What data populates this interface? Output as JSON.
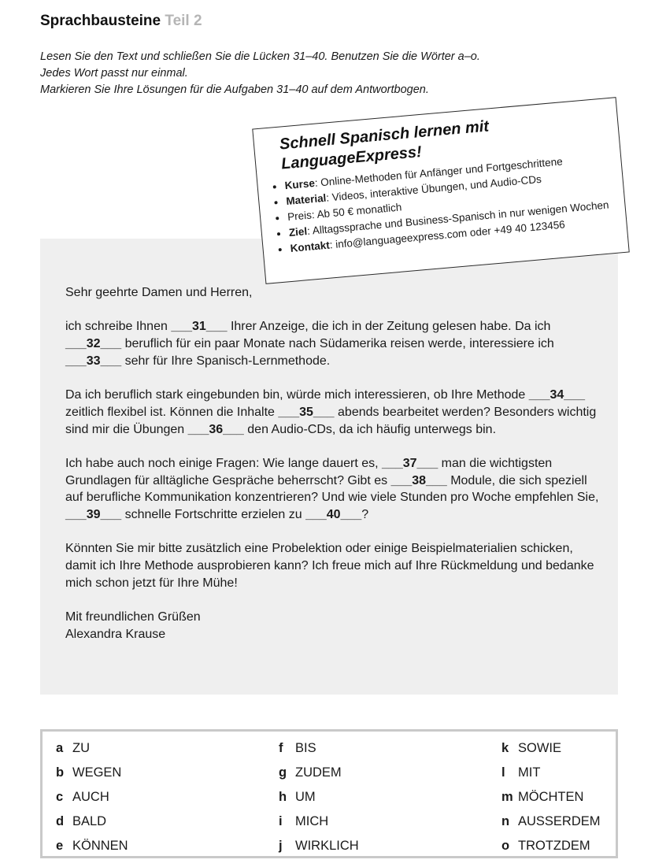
{
  "header": {
    "title": "Sprachbausteine",
    "part": "Teil 2"
  },
  "instructions": [
    "Lesen Sie den Text und schließen Sie die Lücken 31–40. Benutzen Sie die Wörter a–o.",
    "Jedes Wort passt nur einmal.",
    "Markieren Sie Ihre Lösungen für die Aufgaben 31–40 auf dem Antwortbogen."
  ],
  "ad": {
    "title": "Schnell Spanisch lernen mit LanguageExpress!",
    "items": [
      {
        "key": "Kurse",
        "value": ": Online-Methoden für Anfänger und Fortgeschrittene"
      },
      {
        "key": "Material",
        "value": ": Videos, interaktive Übungen, und Audio-CDs"
      },
      {
        "key": "",
        "value": "Preis: Ab 50 € monatlich"
      },
      {
        "key": "Ziel",
        "value": ": Alltagssprache und Business-Spanisch in nur wenigen Wochen"
      },
      {
        "key": "Kontakt",
        "value": ": info@languageexpress.com oder +49 40 123456"
      }
    ]
  },
  "letter": {
    "greeting": "Sehr geehrte Damen und Herren,",
    "p1": {
      "t1": "ich schreibe Ihnen ",
      "g31": "___31___",
      "t2": " Ihrer Anzeige, die ich in der Zeitung gelesen habe. Da ich ",
      "g32": "___32___",
      "t3": " beruflich für ein paar Monate nach Südamerika reisen werde, interessiere ich ",
      "g33": "___33___",
      "t4": " sehr für Ihre Spanisch-Lernmethode."
    },
    "p2": {
      "t1": "Da ich beruflich stark eingebunden bin, würde mich interessieren, ob Ihre Methode ",
      "g34": "___34___",
      "t2": " zeitlich flexibel ist. Können die Inhalte ",
      "g35": "___35___",
      "t3": " abends bearbeitet werden? Besonders wichtig sind mir die Übungen ",
      "g36": "___36___",
      "t4": " den Audio-CDs, da ich häufig unterwegs bin."
    },
    "p3": {
      "t1": "Ich habe auch noch einige Fragen: Wie lange dauert es, ",
      "g37": "___37___",
      "t2": " man die wichtigsten Grundlagen für alltägliche Gespräche beherrscht? Gibt es ",
      "g38": "___38___",
      "t3": " Module, die sich speziell auf berufliche Kommunikation konzentrieren? Und wie viele Stunden pro Woche empfehlen Sie, ",
      "g39": "___39___",
      "t4": " schnelle Fortschritte erzielen zu ",
      "g40": "___40___",
      "t5": "?"
    },
    "p4": "Könnten Sie mir bitte zusätzlich eine Probelektion oder einige Beispielmaterialien schicken, damit ich Ihre Methode ausprobieren kann? Ich freue mich auf Ihre Rückmeldung und bedanke mich schon jetzt für Ihre Mühe!",
    "closing": "Mit freundlichen Grüßen",
    "signature": "Alexandra Krause"
  },
  "words": [
    [
      {
        "letter": "a",
        "word": "ZU"
      },
      {
        "letter": "f",
        "word": "BIS"
      },
      {
        "letter": "k",
        "word": "SOWIE"
      }
    ],
    [
      {
        "letter": "b",
        "word": "WEGEN"
      },
      {
        "letter": "g",
        "word": "ZUDEM"
      },
      {
        "letter": "l",
        "word": "MIT"
      }
    ],
    [
      {
        "letter": "c",
        "word": "AUCH"
      },
      {
        "letter": "h",
        "word": "UM"
      },
      {
        "letter": "m",
        "word": "MÖCHTEN"
      }
    ],
    [
      {
        "letter": "d",
        "word": "BALD"
      },
      {
        "letter": "i",
        "word": "MICH"
      },
      {
        "letter": "n",
        "word": "AUSSERDEM"
      }
    ],
    [
      {
        "letter": "e",
        "word": "KÖNNEN"
      },
      {
        "letter": "j",
        "word": "WIRKLICH"
      },
      {
        "letter": "o",
        "word": "TROTZDEM"
      }
    ]
  ]
}
